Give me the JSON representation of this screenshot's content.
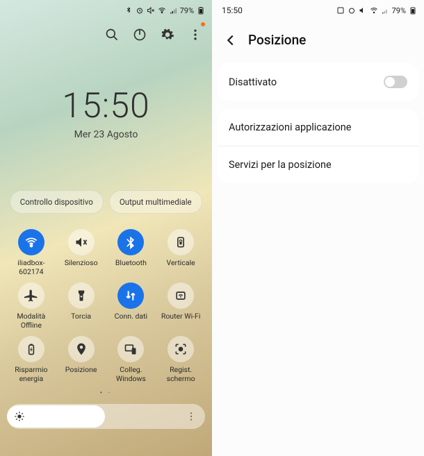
{
  "status": {
    "time": "15:50",
    "battery": "79%"
  },
  "leftPane": {
    "clock": "15:50",
    "date": "Mer 23 Agosto",
    "pills": {
      "device": "Controllo dispositivo",
      "media": "Output multimediale"
    },
    "tiles": [
      {
        "label": "iliadbox-602174",
        "icon": "wifi",
        "on": true
      },
      {
        "label": "Silenzioso",
        "icon": "mute",
        "on": false
      },
      {
        "label": "Bluetooth",
        "icon": "bluetooth",
        "on": true
      },
      {
        "label": "Verticale",
        "icon": "rotate-lock",
        "on": false
      },
      {
        "label": "Modalità Offline",
        "icon": "airplane",
        "on": false
      },
      {
        "label": "Torcia",
        "icon": "flashlight",
        "on": false
      },
      {
        "label": "Conn. dati",
        "icon": "data",
        "on": true
      },
      {
        "label": "Router Wi-Fi",
        "icon": "hotspot",
        "on": false
      },
      {
        "label": "Risparmio energia",
        "icon": "battery-save",
        "on": false
      },
      {
        "label": "Posizione",
        "icon": "location",
        "on": false
      },
      {
        "label": "Colleg. Windows",
        "icon": "link-windows",
        "on": false
      },
      {
        "label": "Regist. schermo",
        "icon": "screen-record",
        "on": false
      }
    ]
  },
  "rightPane": {
    "title": "Posizione",
    "toggleLabel": "Disattivato",
    "toggleOn": false,
    "rows": {
      "perm": "Autorizzazioni applicazione",
      "services": "Servizi per la posizione"
    }
  }
}
